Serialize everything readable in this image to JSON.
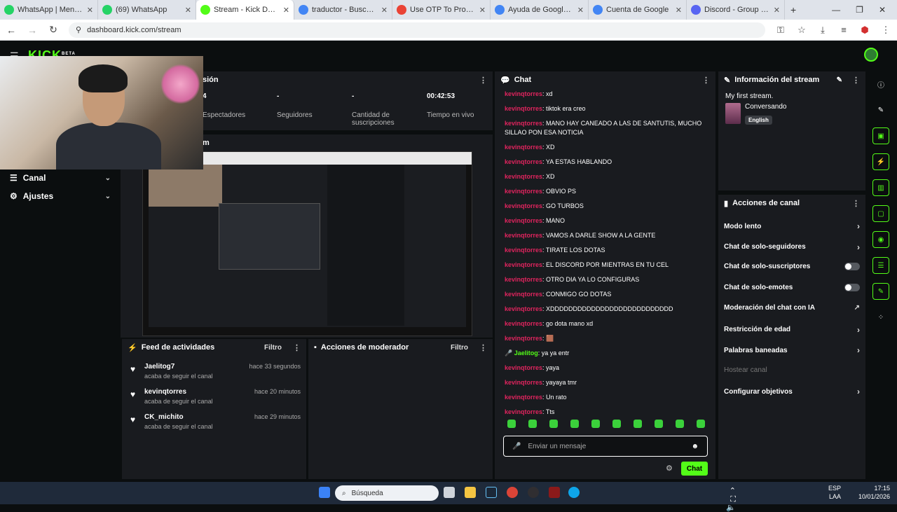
{
  "browser": {
    "tabs": [
      {
        "title": "WhatsApp | Mensajería y llamadas",
        "color": "#25d366"
      },
      {
        "title": "(69) WhatsApp",
        "color": "#25d366"
      },
      {
        "title": "Stream - Kick Dashboard",
        "color": "#53fc18",
        "active": true
      },
      {
        "title": "traductor - Buscar con Google",
        "color": "#4285f4"
      },
      {
        "title": "Use OTP To Proceed - client",
        "color": "#ea4335"
      },
      {
        "title": "Ayuda de Google Chrome",
        "color": "#4285f4"
      },
      {
        "title": "Cuenta de Google",
        "color": "#4285f4"
      },
      {
        "title": "Discord - Group Chat That's",
        "color": "#5865f2"
      }
    ],
    "url": "dashboard.kick.com/stream"
  },
  "app": {
    "logo": "KICK",
    "logo_badge": "BETA",
    "accent": "#53fc18",
    "sidebar": [
      {
        "label": "Canal",
        "icon": "hamburger-icon"
      },
      {
        "label": "Ajustes",
        "icon": "gear-icon"
      }
    ]
  },
  "session": {
    "title": "sión",
    "stats": [
      {
        "value": "4",
        "label": "Espectadores"
      },
      {
        "value": "-",
        "label": "Seguidores"
      },
      {
        "value": "-",
        "label": "Cantidad de suscripciones"
      },
      {
        "value": "00:42:53",
        "label": "Tiempo en vivo"
      }
    ],
    "preview_title": "m"
  },
  "feed": {
    "title": "Feed de actividades",
    "filter": "Filtro",
    "items": [
      {
        "name": "Jaelitog7",
        "time": "hace 33 segundos",
        "desc": "acaba de seguir el canal"
      },
      {
        "name": "kevinqtorres",
        "time": "hace 20 minutos",
        "desc": "acaba de seguir el canal"
      },
      {
        "name": "CK_michito",
        "time": "hace 29 minutos",
        "desc": "acaba de seguir el canal"
      }
    ]
  },
  "mod": {
    "title": "Acciones de moderador",
    "filter": "Filtro"
  },
  "chat": {
    "title": "Chat",
    "messages": [
      {
        "user": "kevinqtorres",
        "text": ": xd"
      },
      {
        "user": "kevinqtorres",
        "text": ": tiktok era creo"
      },
      {
        "user": "kevinqtorres",
        "text": ": MANO HAY CANEADO A LAS DE SANTUTIS, MUCHO SILLAO PON ESA NOTICIA"
      },
      {
        "user": "kevinqtorres",
        "text": ": XD"
      },
      {
        "user": "kevinqtorres",
        "text": ": YA ESTAS HABLANDO"
      },
      {
        "user": "kevinqtorres",
        "text": ": XD"
      },
      {
        "user": "kevinqtorres",
        "text": ": OBVIO PS"
      },
      {
        "user": "kevinqtorres",
        "text": ": GO TURBOS"
      },
      {
        "user": "kevinqtorres",
        "text": ": MANO"
      },
      {
        "user": "kevinqtorres",
        "text": ": VAMOS A DARLE SHOW A LA GENTE"
      },
      {
        "user": "kevinqtorres",
        "text": ": TIRATE LOS DOTAS"
      },
      {
        "user": "kevinqtorres",
        "text": ": EL DISCORD POR MIENTRAS EN TU CEL"
      },
      {
        "user": "kevinqtorres",
        "text": ": OTRO DIA YA LO CONFIGURAS"
      },
      {
        "user": "kevinqtorres",
        "text": ": CONMIGO GO DOTAS"
      },
      {
        "user": "kevinqtorres",
        "text": ": XDDDDDDDDDDDDDDDDDDDDDDDDDDD"
      },
      {
        "user": "kevinqtorres",
        "text": ": go dota mano xd"
      },
      {
        "user": "kevinqtorres",
        "text": ": 🟫"
      },
      {
        "user": "Jaelitog",
        "text": ": ya ya entr",
        "green": true
      },
      {
        "user": "kevinqtorres",
        "text": ": yaya"
      },
      {
        "user": "kevinqtorres",
        "text": ": yayaya tmr"
      },
      {
        "user": "kevinqtorres",
        "text": ": Un rato"
      },
      {
        "user": "kevinqtorres",
        "text": ": Tts"
      }
    ],
    "input_placeholder": "Enviar un mensaje",
    "send_label": "Chat"
  },
  "info": {
    "title": "Información del stream",
    "stream_title": "My first stream.",
    "category": "Conversando",
    "language": "English"
  },
  "actions": {
    "title": "Acciones de canal",
    "items": [
      {
        "label": "Modo lento",
        "kind": "arrow"
      },
      {
        "label": "Chat de solo-seguidores",
        "kind": "arrow"
      },
      {
        "label": "Chat de solo-suscriptores",
        "kind": "toggle"
      },
      {
        "label": "Chat de solo-emotes",
        "kind": "toggle"
      },
      {
        "label": "Moderación del chat con IA",
        "kind": "link"
      },
      {
        "label": "Restricción de edad",
        "kind": "arrow"
      },
      {
        "label": "Palabras baneadas",
        "kind": "arrow"
      },
      {
        "label": "Hostear canal",
        "kind": "disabled"
      },
      {
        "label": "Configurar objetivos",
        "kind": "arrow"
      }
    ]
  },
  "taskbar": {
    "search_placeholder": "Búsqueda",
    "lang": "ESP",
    "lang2": "LAA",
    "time": "17:15",
    "date": "10/01/2026"
  }
}
